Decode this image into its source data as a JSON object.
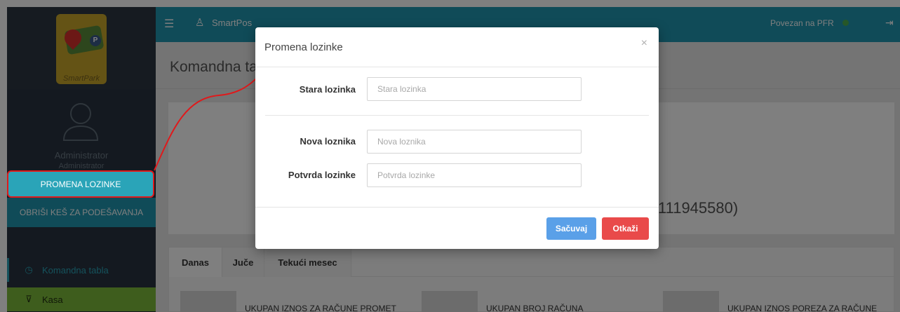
{
  "sidebar": {
    "logo_text": "SmartPark",
    "logo_badge": "P",
    "user_name": "Administrator",
    "user_role": "Administrator",
    "change_password": "PROMENA LOZINKE",
    "clear_cache": "OBRIŠI KEŠ ZA PODEŠAVANJA",
    "menu": [
      {
        "label": "Komandna tabla",
        "icon": "gauge-icon"
      },
      {
        "label": "Kasa",
        "icon": "cart-icon"
      }
    ]
  },
  "header": {
    "app_name": "SmartPos",
    "pfr_status": "Povezan na PFR",
    "pfr_status_color": "#4caf50"
  },
  "page": {
    "title": "Komandna ta",
    "company_id": "111945580)",
    "tabs": [
      "Danas",
      "Juče",
      "Tekući mesec"
    ],
    "tiles": [
      {
        "label": "UKUPAN IZNOS ZA RAČUNE PROMET"
      },
      {
        "label": "UKUPAN BROJ RAČUNA"
      },
      {
        "label": "UKUPAN IZNOS POREZA ZA RAČUNE"
      }
    ]
  },
  "modal": {
    "title": "Promena lozinke",
    "close": "×",
    "fields": [
      {
        "label": "Stara lozinka",
        "placeholder": "Stara lozinka",
        "value": ""
      },
      {
        "label": "Nova loznika",
        "placeholder": "Nova loznika",
        "value": ""
      },
      {
        "label": "Potvrda lozinke",
        "placeholder": "Potvrda lozinke",
        "value": ""
      }
    ],
    "save": "Sačuvaj",
    "cancel": "Otkaži"
  },
  "colors": {
    "accent": "#2196b0",
    "sidebar_bg": "#283340",
    "save_button": "#5aa0e8",
    "cancel_button": "#e94a4a",
    "annotation": "#e0191b"
  }
}
